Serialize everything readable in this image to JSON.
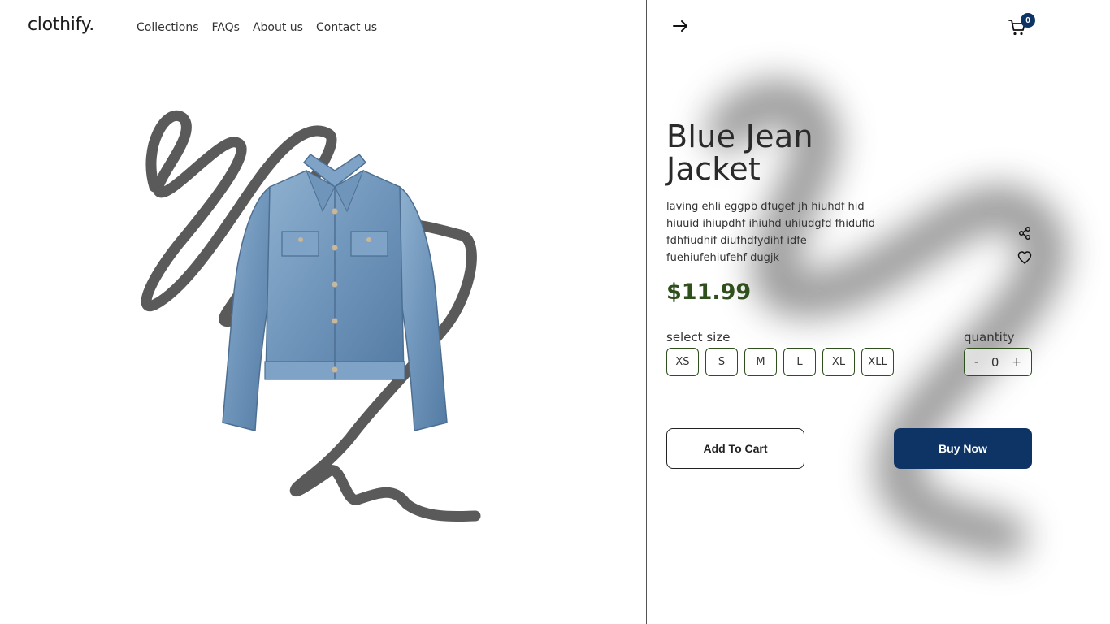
{
  "brand": {
    "name": "clothify."
  },
  "nav": {
    "items": [
      {
        "label": "Collections"
      },
      {
        "label": "FAQs"
      },
      {
        "label": "About us"
      },
      {
        "label": "Contact us"
      }
    ]
  },
  "header": {
    "back_icon": "arrow-right-icon",
    "cart_icon": "cart-icon",
    "cart_count": "0"
  },
  "product": {
    "image_icon": "denim-jacket-image",
    "title": "Blue Jean Jacket",
    "description": "laving ehli eggpb dfugef jh hiuhdf hid hiuuid ihiupdhf ihiuhd uhiudgfd fhidufid fdhfiudhif diufhdfydihf idfe fuehiufehiufehf dugjk",
    "price": "$11.99",
    "share_icon": "share-icon",
    "wishlist_icon": "heart-icon"
  },
  "size": {
    "label": "select size",
    "options": [
      "XS",
      "S",
      "M",
      "L",
      "XL",
      "XLL"
    ]
  },
  "quantity": {
    "label": "quantity",
    "minus": "-",
    "value": "0",
    "plus": "+"
  },
  "actions": {
    "add_to_cart": "Add To Cart",
    "buy_now": "Buy Now"
  },
  "colors": {
    "accent": "#0d3465",
    "price": "#2f4f1d",
    "border": "#2f4f1d"
  }
}
